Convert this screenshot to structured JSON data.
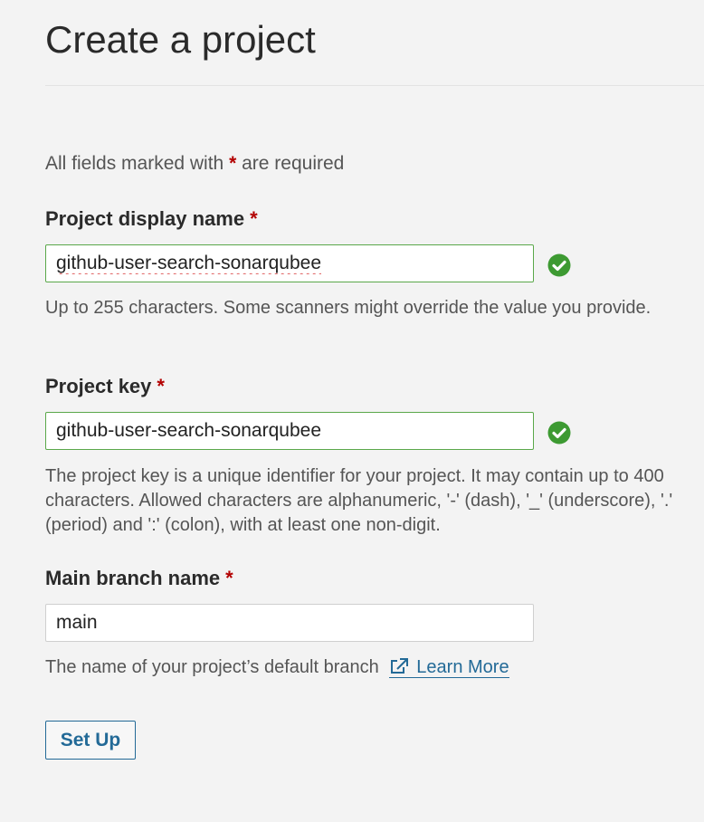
{
  "page": {
    "title": "Create a project"
  },
  "form": {
    "required_prefix": "All fields marked with",
    "required_star": "*",
    "required_suffix": "are required",
    "display_name": {
      "label": "Project display name",
      "star": "*",
      "value": "github-user-search-sonarqubee",
      "help": "Up to 255 characters. Some scanners might override the value you provide."
    },
    "project_key": {
      "label": "Project key",
      "star": "*",
      "value": "github-user-search-sonarqubee",
      "help": "The project key is a unique identifier for your project. It may contain up to 400 characters. Allowed characters are alphanumeric, '-' (dash), '_' (underscore), '.' (period) and ':' (colon), with at least one non-digit."
    },
    "main_branch": {
      "label": "Main branch name",
      "star": "*",
      "value": "main",
      "help": "The name of your project’s default branch",
      "link_label": "Learn More"
    },
    "submit_label": "Set Up"
  },
  "colors": {
    "valid_green": "#5aa84a",
    "check_green": "#3d9a32",
    "required_red": "#b30000",
    "link_blue": "#236a97"
  },
  "icons": {
    "valid": "check-circle-icon",
    "external": "external-link-icon"
  }
}
